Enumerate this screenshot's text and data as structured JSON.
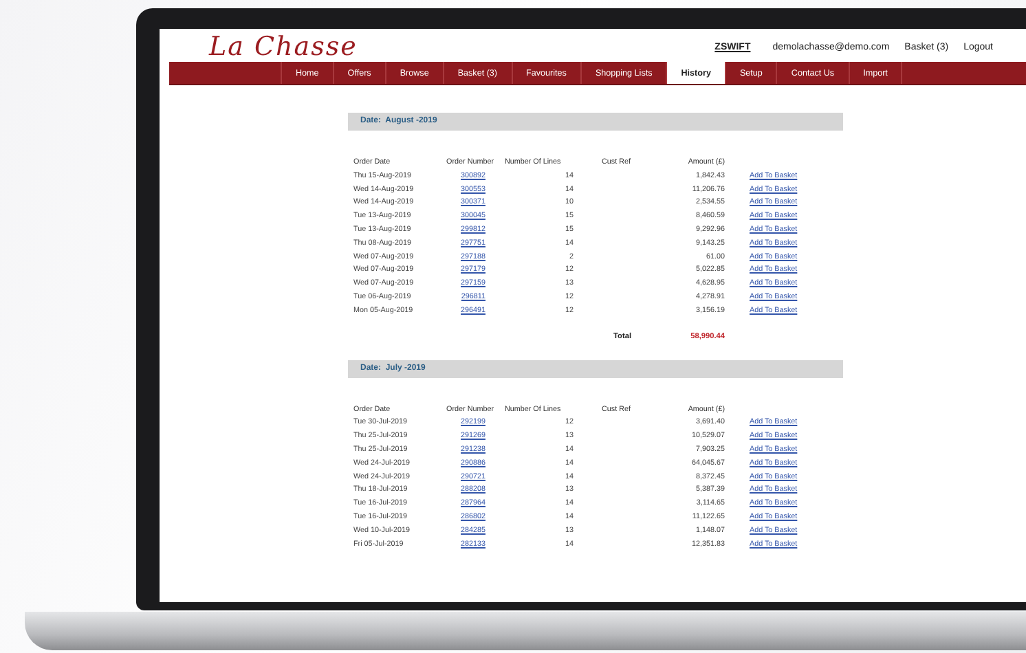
{
  "logo": "La Chasse",
  "account": {
    "user": "ZSWIFT",
    "email": "demolachasse@demo.com",
    "basket": "Basket (3)",
    "logout": "Logout"
  },
  "nav": [
    {
      "label": "Home",
      "selected": false
    },
    {
      "label": "Offers",
      "selected": false
    },
    {
      "label": "Browse",
      "selected": false
    },
    {
      "label": "Basket (3)",
      "selected": false
    },
    {
      "label": "Favourites",
      "selected": false
    },
    {
      "label": "Shopping Lists",
      "selected": false
    },
    {
      "label": "History",
      "selected": true
    },
    {
      "label": "Setup",
      "selected": false
    },
    {
      "label": "Contact Us",
      "selected": false
    },
    {
      "label": "Import",
      "selected": false
    }
  ],
  "sections": [
    {
      "title": "Date:  August -2019",
      "columns": [
        "Order Date",
        "Order Number",
        "Number Of Lines",
        "Cust Ref",
        "Amount (£)"
      ],
      "total_label": "Total",
      "total": "58,990.44",
      "rows": [
        {
          "date": "Thu 15-Aug-2019",
          "order": "300892",
          "lines": "14",
          "amount": "1,842.43",
          "action": "Add To Basket"
        },
        {
          "date": "Wed 14-Aug-2019",
          "order": "300553",
          "lines": "14",
          "amount": "11,206.76",
          "action": "Add To Basket"
        },
        {
          "date": "Wed 14-Aug-2019",
          "order": "300371",
          "lines": "10",
          "amount": "2,534.55",
          "action": "Add To Basket"
        },
        {
          "date": "Tue 13-Aug-2019",
          "order": "300045",
          "lines": "15",
          "amount": "8,460.59",
          "action": "Add To Basket"
        },
        {
          "date": "Tue 13-Aug-2019",
          "order": "299812",
          "lines": "15",
          "amount": "9,292.96",
          "action": "Add To Basket"
        },
        {
          "date": "Thu 08-Aug-2019",
          "order": "297751",
          "lines": "14",
          "amount": "9,143.25",
          "action": "Add To Basket"
        },
        {
          "date": "Wed 07-Aug-2019",
          "order": "297188",
          "lines": "2",
          "amount": "61.00",
          "action": "Add To Basket"
        },
        {
          "date": "Wed 07-Aug-2019",
          "order": "297179",
          "lines": "12",
          "amount": "5,022.85",
          "action": "Add To Basket"
        },
        {
          "date": "Wed 07-Aug-2019",
          "order": "297159",
          "lines": "13",
          "amount": "4,628.95",
          "action": "Add To Basket"
        },
        {
          "date": "Tue 06-Aug-2019",
          "order": "296811",
          "lines": "12",
          "amount": "4,278.91",
          "action": "Add To Basket"
        },
        {
          "date": "Mon 05-Aug-2019",
          "order": "296491",
          "lines": "12",
          "amount": "3,156.19",
          "action": "Add To Basket"
        }
      ]
    },
    {
      "title": "Date:  July -2019",
      "columns": [
        "Order Date",
        "Order Number",
        "Number Of Lines",
        "Cust Ref",
        "Amount (£)"
      ],
      "rows": [
        {
          "date": "Tue 30-Jul-2019",
          "order": "292199",
          "lines": "12",
          "amount": "3,691.40",
          "action": "Add To Basket"
        },
        {
          "date": "Thu 25-Jul-2019",
          "order": "291269",
          "lines": "13",
          "amount": "10,529.07",
          "action": "Add To Basket"
        },
        {
          "date": "Thu 25-Jul-2019",
          "order": "291238",
          "lines": "14",
          "amount": "7,903.25",
          "action": "Add To Basket"
        },
        {
          "date": "Wed 24-Jul-2019",
          "order": "290886",
          "lines": "14",
          "amount": "64,045.67",
          "action": "Add To Basket"
        },
        {
          "date": "Wed 24-Jul-2019",
          "order": "290721",
          "lines": "14",
          "amount": "8,372.45",
          "action": "Add To Basket"
        },
        {
          "date": "Thu 18-Jul-2019",
          "order": "288208",
          "lines": "13",
          "amount": "5,387.39",
          "action": "Add To Basket"
        },
        {
          "date": "Tue 16-Jul-2019",
          "order": "287964",
          "lines": "14",
          "amount": "3,114.65",
          "action": "Add To Basket"
        },
        {
          "date": "Tue 16-Jul-2019",
          "order": "286802",
          "lines": "14",
          "amount": "11,122.65",
          "action": "Add To Basket"
        },
        {
          "date": "Wed 10-Jul-2019",
          "order": "284285",
          "lines": "13",
          "amount": "1,148.07",
          "action": "Add To Basket"
        },
        {
          "date": "Fri 05-Jul-2019",
          "order": "282133",
          "lines": "14",
          "amount": "12,351.83",
          "action": "Add To Basket"
        }
      ]
    }
  ]
}
